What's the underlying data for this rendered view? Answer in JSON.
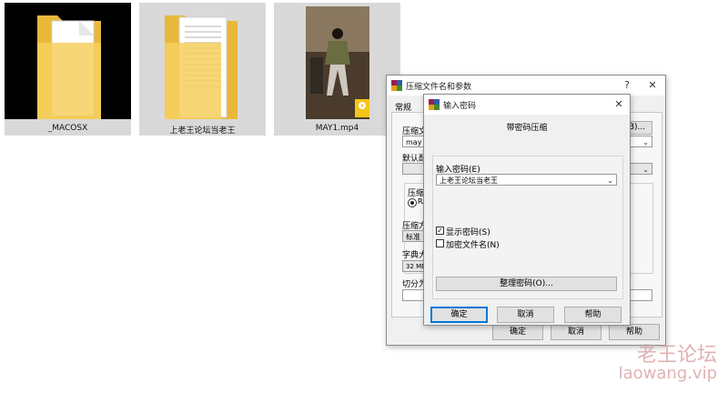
{
  "files": [
    {
      "name": "_MACOSX",
      "icon": "folder-icon"
    },
    {
      "name": "上老王论坛当老王",
      "icon": "folder-icon"
    },
    {
      "name": "MAY1.mp4",
      "icon": "video-thumbnail",
      "badge": "Player"
    }
  ],
  "archive_dialog": {
    "title": "压缩文件名和参数",
    "help_btn": "?",
    "close_btn": "✕",
    "tab_general": "常规",
    "archive_name_label": "压缩文",
    "browse_label": "B)...",
    "archive_name_value": "may j",
    "default_profile_label": "默认配",
    "format_group_label": "压缩",
    "format_radio_label": "RA",
    "method_label": "压缩方",
    "method_value": "标准",
    "dict_label": "字典大",
    "dict_value": "32 MB",
    "split_label": "切分为",
    "ok_label": "确定",
    "cancel_label": "取消",
    "help_label": "帮助"
  },
  "password_dialog": {
    "title": "输入密码",
    "close_btn": "✕",
    "heading": "带密码压缩",
    "password_label": "输入密码(E)",
    "password_value": "上老王论坛当老王",
    "show_password_label": "显示密码(S)",
    "show_password_checked": true,
    "encrypt_names_label": "加密文件名(N)",
    "encrypt_names_checked": false,
    "organize_label": "整理密码(O)...",
    "ok_label": "确定",
    "cancel_label": "取消",
    "help_label": "帮助"
  },
  "watermark": {
    "line1": "老王论坛",
    "line2": "laowang.vip"
  },
  "colors": {
    "accent": "#0078d7",
    "folder_yellow": "#f3c54f",
    "watermark": "#d9a0a0"
  }
}
